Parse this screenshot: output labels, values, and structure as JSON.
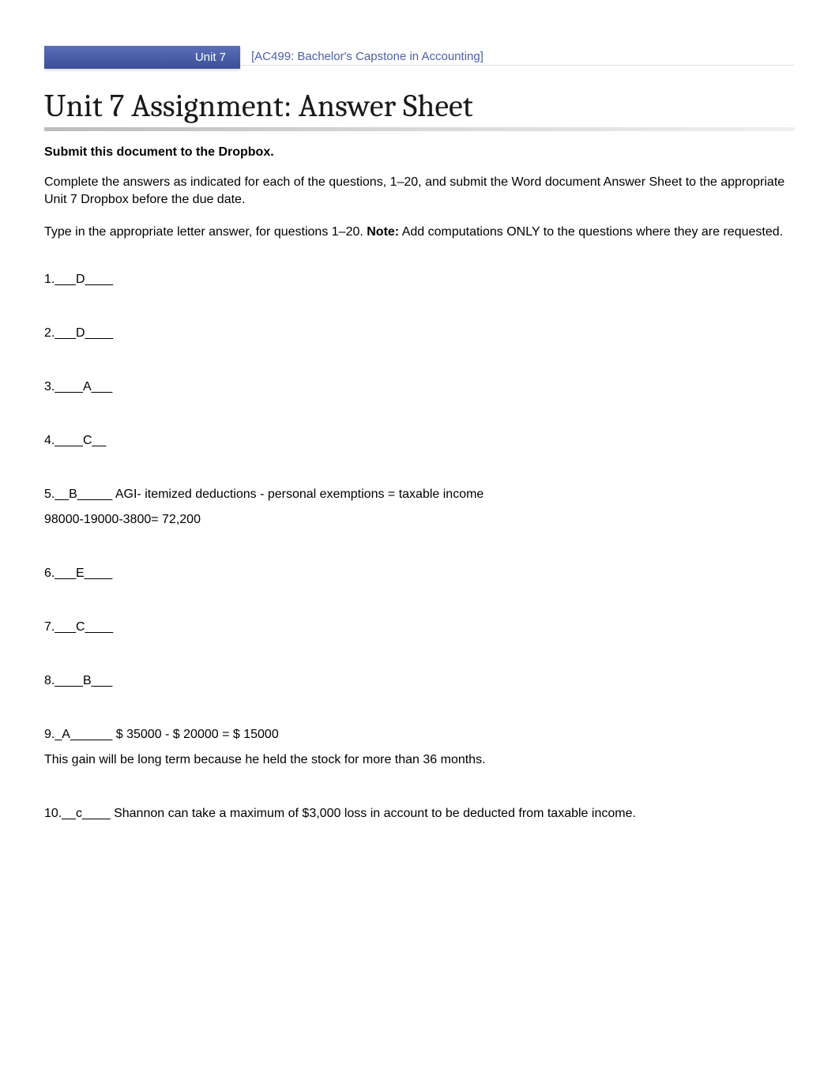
{
  "header": {
    "unit_badge": "Unit 7",
    "course_label": "[AC499: Bachelor's Capstone in Accounting]"
  },
  "title": "Unit 7 Assignment: Answer Sheet",
  "submit_instruction": "Submit this document to the Dropbox.",
  "instruction_1": "Complete the answers as indicated for each of the questions, 1–20, and submit the Word document Answer Sheet to the appropriate Unit 7 Dropbox before the due date.",
  "instruction_2_pre": "Type in the appropriate letter answer, for questions 1–20. ",
  "instruction_2_note_label": "Note:",
  "instruction_2_post": " Add computations ONLY to the questions where they are requested.",
  "answers": {
    "a1": "1.___D____",
    "a2": "2.___D____",
    "a3": "3.____A___",
    "a4": "4.____C__",
    "a5": "5.__B_____ AGI- itemized deductions - personal exemptions = taxable income",
    "a5_detail": "98000-19000-3800= 72,200",
    "a6": "6.___E____",
    "a7": "7.___C____",
    "a8": "8.____B___",
    "a9": "9._A______ $ 35000 - $ 20000 = $ 15000",
    "a9_detail": "This gain will be long term because he held the stock for more than 36 months.",
    "a10": "10.__c____ Shannon can take a maximum of $3,000 loss in account to be deducted from taxable income."
  }
}
